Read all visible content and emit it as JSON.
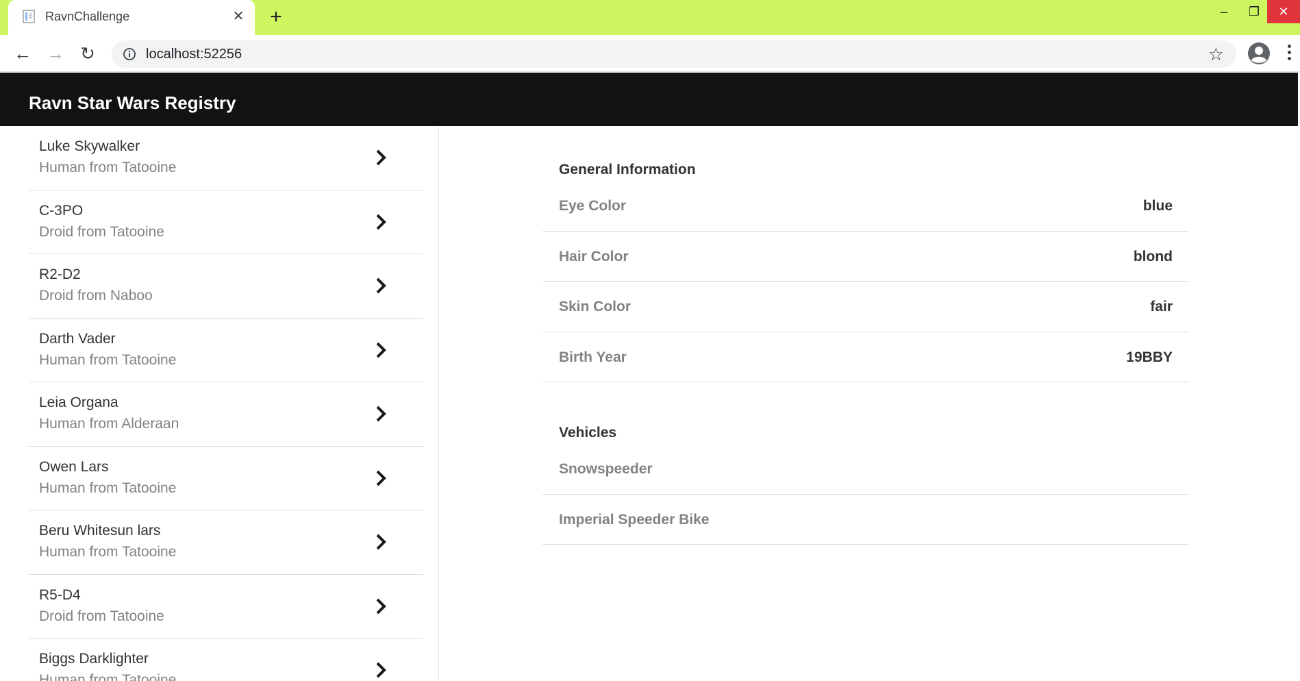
{
  "browser": {
    "tab_title": "RavnChallenge",
    "url": "localhost:52256"
  },
  "app": {
    "title": "Ravn Star Wars Registry"
  },
  "people": [
    {
      "name": "Luke Skywalker",
      "description": "Human from Tatooine"
    },
    {
      "name": "C-3PO",
      "description": "Droid from Tatooine"
    },
    {
      "name": "R2-D2",
      "description": "Droid from Naboo"
    },
    {
      "name": "Darth Vader",
      "description": "Human from Tatooine"
    },
    {
      "name": "Leia Organa",
      "description": "Human from Alderaan"
    },
    {
      "name": "Owen Lars",
      "description": "Human from Tatooine"
    },
    {
      "name": "Beru Whitesun lars",
      "description": "Human from Tatooine"
    },
    {
      "name": "R5-D4",
      "description": "Droid from Tatooine"
    },
    {
      "name": "Biggs Darklighter",
      "description": "Human from Tatooine"
    }
  ],
  "detail": {
    "general_title": "General Information",
    "general": [
      {
        "label": "Eye Color",
        "value": "blue"
      },
      {
        "label": "Hair Color",
        "value": "blond"
      },
      {
        "label": "Skin Color",
        "value": "fair"
      },
      {
        "label": "Birth Year",
        "value": "19BBY"
      }
    ],
    "vehicles_title": "Vehicles",
    "vehicles": [
      "Snowspeeder",
      "Imperial Speeder Bike"
    ]
  }
}
